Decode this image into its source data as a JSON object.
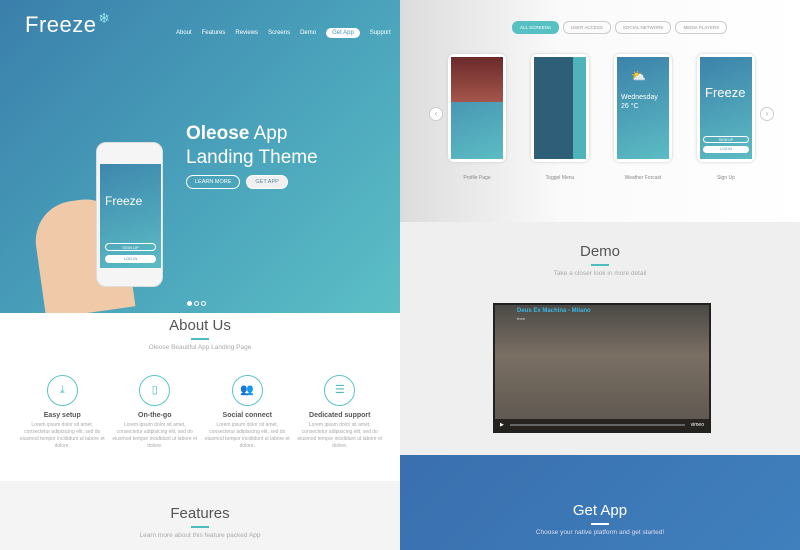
{
  "hero": {
    "logo": "Freeze",
    "nav": [
      "About",
      "Features",
      "Reviews",
      "Screens",
      "Demo",
      "Get App",
      "Support"
    ],
    "title_bold": "Oleose",
    "title_rest": " App",
    "title_line2": "Landing Theme",
    "learn_more": "LEARN MORE",
    "get_app": "GET APP",
    "phone_logo": "Freeze",
    "phone_signup": "SIGN UP",
    "phone_login": "LOG IN"
  },
  "about": {
    "title": "About Us",
    "subtitle": "Oleose Beautiful App Landing Page",
    "features": [
      {
        "icon": "download-icon",
        "title": "Easy setup",
        "text": "Lorem ipsum dolor sit amet, consectetur adipisicing elit, sed do eiusmod tempor incididunt ut labore et dolore."
      },
      {
        "icon": "mobile-icon",
        "title": "On-the-go",
        "text": "Lorem ipsum dolor sit amet, consectetur adipisicing elit, sed do eiusmod tempor incididunt ut labore et dolore."
      },
      {
        "icon": "users-icon",
        "title": "Social connect",
        "text": "Lorem ipsum dolor sit amet, consectetur adipisicing elit, sed do eiusmod tempor incididunt ut labore et dolore."
      },
      {
        "icon": "sliders-icon",
        "title": "Dedicated support",
        "text": "Lorem ipsum dolor sit amet, consectetur adipisicing elit, sed do eiusmod tempor incididunt ut labore et dolore."
      }
    ]
  },
  "features": {
    "title": "Features",
    "subtitle": "Learn more about this feature packed App"
  },
  "screens": {
    "tabs": [
      "ALL SCREENS",
      "USER ACCESS",
      "SOCIAL NETWORK",
      "MEDIA PLAYERS"
    ],
    "captions": [
      "Profile Page",
      "Toggel Menu",
      "Weather Forcast",
      "Sign Up"
    ],
    "weather_day": "Wednesday",
    "weather_temp": "26 °C",
    "signup_logo": "Freeze",
    "signup_btn": "SIGN UP",
    "login_btn": "LOG IN"
  },
  "demo": {
    "title": "Demo",
    "subtitle": "Take a closer look in more detail",
    "video_title": "Deus Ex Machina - Milano",
    "video_by": "from",
    "video_brand": "vimeo"
  },
  "getapp": {
    "title": "Get App",
    "subtitle": "Choose your native platform and get started!"
  },
  "colors": {
    "accent": "#4bbdc0",
    "hero_start": "#3a7fab",
    "hero_end": "#5cc0c6",
    "getapp_bg": "#3a6fae"
  }
}
